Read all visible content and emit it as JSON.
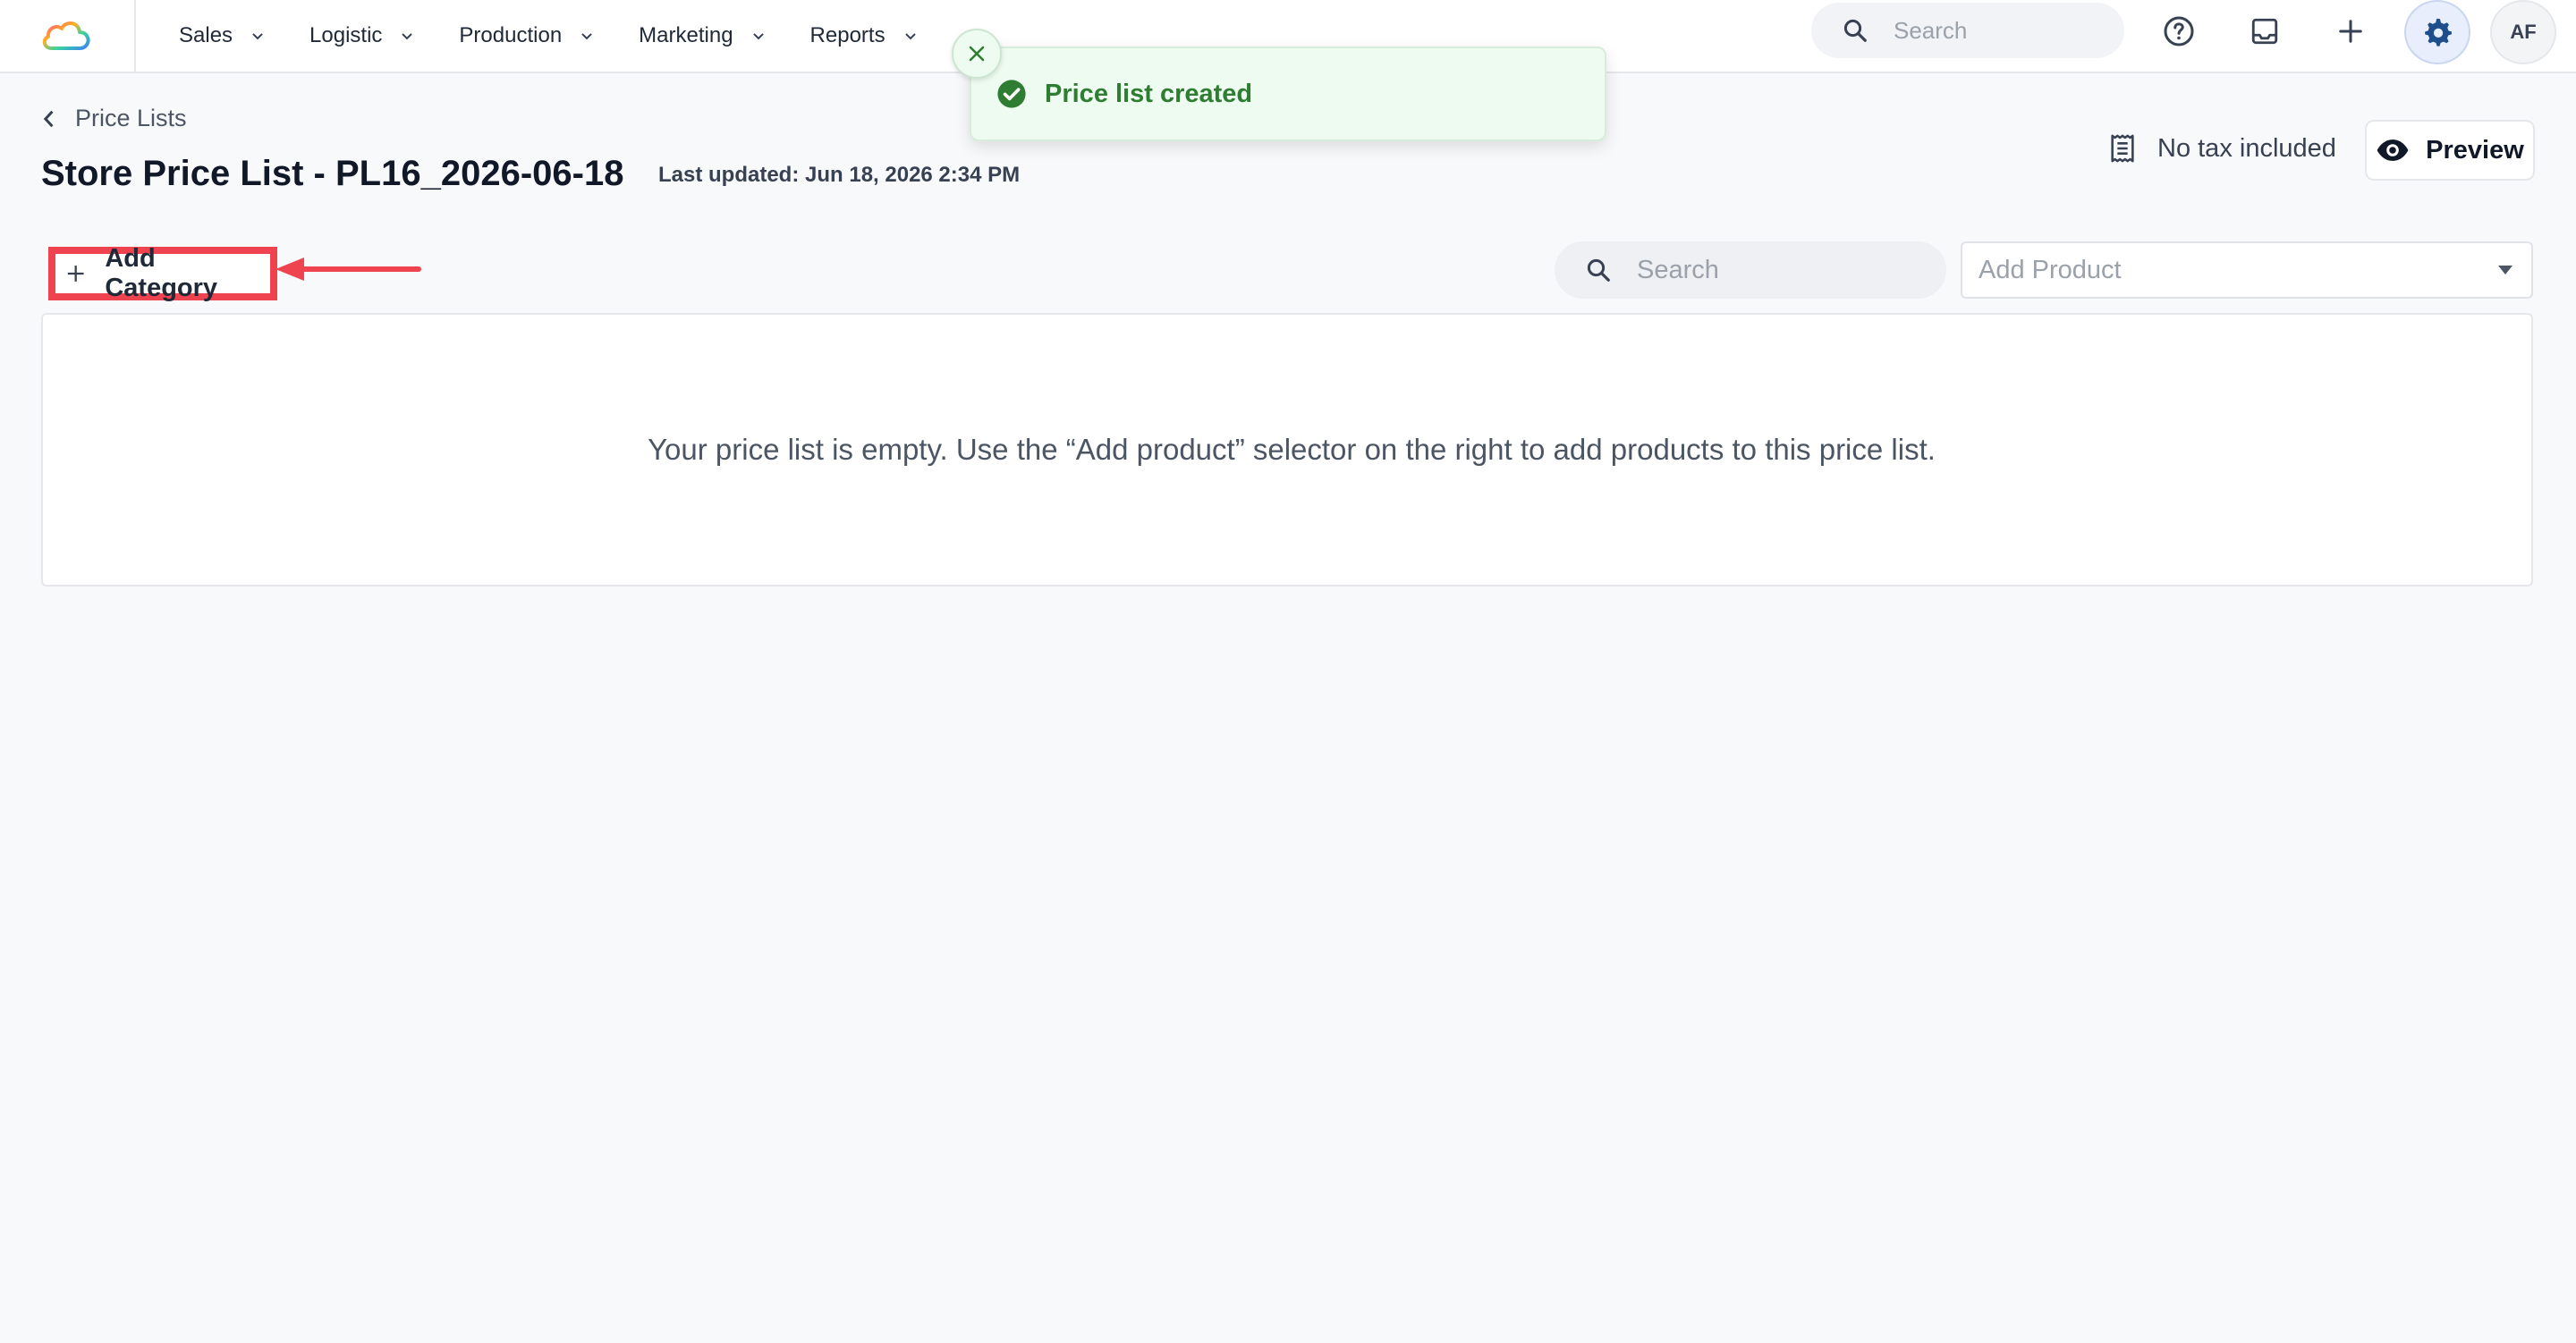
{
  "nav": {
    "items": [
      {
        "label": "Sales"
      },
      {
        "label": "Logistic"
      },
      {
        "label": "Production"
      },
      {
        "label": "Marketing"
      },
      {
        "label": "Reports"
      }
    ]
  },
  "header": {
    "search_placeholder": "Search",
    "avatar_initials": "AF",
    "icons": [
      "help-icon",
      "inbox-icon",
      "plus-icon",
      "gear-icon"
    ]
  },
  "toast": {
    "message": "Price list created",
    "icon": "check-circle-icon"
  },
  "page": {
    "breadcrumb": "Price Lists",
    "title": "Store Price List - PL16_2026-06-18",
    "last_updated": "Last updated: Jun 18, 2026 2:34 PM",
    "tax_label": "No tax included",
    "preview_label": "Preview"
  },
  "toolbar": {
    "add_category_label": "Add Category",
    "search_placeholder": "Search",
    "add_product_placeholder": "Add Product"
  },
  "empty_state": {
    "message": "Your price list is empty. Use the “Add product” selector on the right to add products to this price list."
  },
  "colors": {
    "accent": "#1e4e8c",
    "success": "#2e7d32",
    "annotation": "#ef4350",
    "background": "#f8f9fb"
  }
}
